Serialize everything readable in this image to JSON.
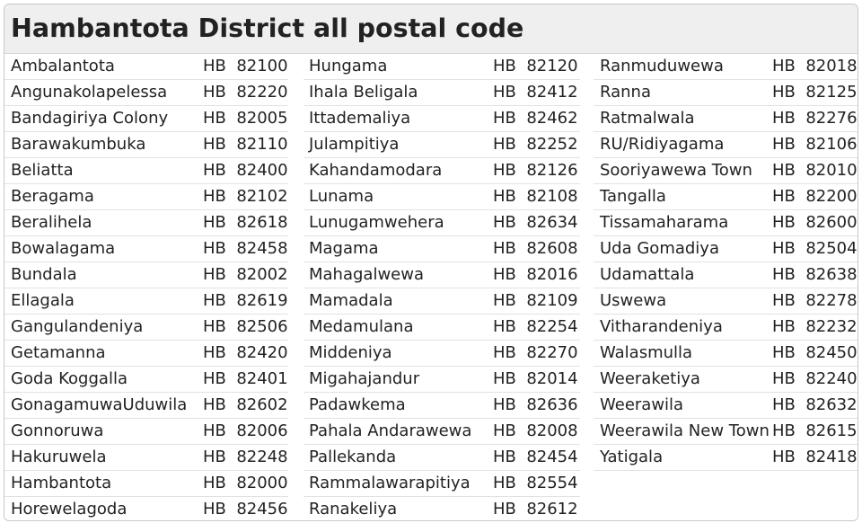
{
  "page": {
    "title": "Hambantota District all postal code"
  },
  "columns": [
    {
      "rows": [
        {
          "name": "Ambalantota",
          "code": "HB  82100"
        },
        {
          "name": "Angunakolapelessa",
          "code": "HB  82220"
        },
        {
          "name": "Bandagiriya Colony",
          "code": "HB  82005"
        },
        {
          "name": "Barawakumbuka",
          "code": "HB  82110"
        },
        {
          "name": "Beliatta",
          "code": "HB  82400"
        },
        {
          "name": "Beragama",
          "code": "HB  82102"
        },
        {
          "name": "Beralihela",
          "code": "HB  82618"
        },
        {
          "name": "Bowalagama",
          "code": "HB  82458"
        },
        {
          "name": "Bundala",
          "code": "HB  82002"
        },
        {
          "name": "Ellagala",
          "code": "HB  82619"
        },
        {
          "name": "Gangulandeniya",
          "code": "HB  82506"
        },
        {
          "name": "Getamanna",
          "code": "HB  82420"
        },
        {
          "name": "Goda Koggalla",
          "code": "HB  82401"
        },
        {
          "name": "GonagamuwaUduwila",
          "code": "HB  82602"
        },
        {
          "name": "Gonnoruwa",
          "code": "HB  82006"
        },
        {
          "name": "Hakuruwela",
          "code": "HB  82248"
        },
        {
          "name": "Hambantota",
          "code": "HB  82000"
        },
        {
          "name": "Horewelagoda",
          "code": "HB  82456"
        }
      ]
    },
    {
      "rows": [
        {
          "name": "Hungama",
          "code": "HB  82120"
        },
        {
          "name": "Ihala Beligala",
          "code": "HB  82412"
        },
        {
          "name": "Ittademaliya",
          "code": "HB  82462"
        },
        {
          "name": "Julampitiya",
          "code": "HB  82252"
        },
        {
          "name": "Kahandamodara",
          "code": "HB  82126"
        },
        {
          "name": "Lunama",
          "code": "HB  82108"
        },
        {
          "name": "Lunugamwehera",
          "code": "HB  82634"
        },
        {
          "name": "Magama",
          "code": "HB  82608"
        },
        {
          "name": "Mahagalwewa",
          "code": "HB  82016"
        },
        {
          "name": "Mamadala",
          "code": "HB  82109"
        },
        {
          "name": "Medamulana",
          "code": "HB  82254"
        },
        {
          "name": "Middeniya",
          "code": "HB  82270"
        },
        {
          "name": "Migahajandur",
          "code": "HB  82014"
        },
        {
          "name": "Padawkema",
          "code": "HB  82636"
        },
        {
          "name": "Pahala Andarawewa",
          "code": "HB  82008"
        },
        {
          "name": "Pallekanda",
          "code": "HB  82454"
        },
        {
          "name": "Rammalawarapitiya",
          "code": "HB  82554"
        },
        {
          "name": "Ranakeliya",
          "code": "HB  82612"
        }
      ]
    },
    {
      "rows": [
        {
          "name": "Ranmuduwewa",
          "code": "HB  82018"
        },
        {
          "name": "Ranna",
          "code": "HB  82125"
        },
        {
          "name": "Ratmalwala",
          "code": "HB  82276"
        },
        {
          "name": "RU/Ridiyagama",
          "code": "HB  82106"
        },
        {
          "name": "Sooriyawewa Town",
          "code": "HB  82010"
        },
        {
          "name": "Tangalla",
          "code": "HB  82200"
        },
        {
          "name": "Tissamaharama",
          "code": "HB  82600"
        },
        {
          "name": "Uda Gomadiya",
          "code": "HB  82504"
        },
        {
          "name": "Udamattala",
          "code": "HB  82638"
        },
        {
          "name": "Uswewa",
          "code": "HB  82278"
        },
        {
          "name": "Vitharandeniya",
          "code": "HB  82232"
        },
        {
          "name": "Walasmulla",
          "code": "HB  82450"
        },
        {
          "name": "Weeraketiya",
          "code": "HB  82240"
        },
        {
          "name": "Weerawila",
          "code": "HB  82632"
        },
        {
          "name": "Weerawila New Town",
          "code": "HB  82615"
        },
        {
          "name": "Yatigala",
          "code": "HB  82418"
        }
      ]
    }
  ]
}
